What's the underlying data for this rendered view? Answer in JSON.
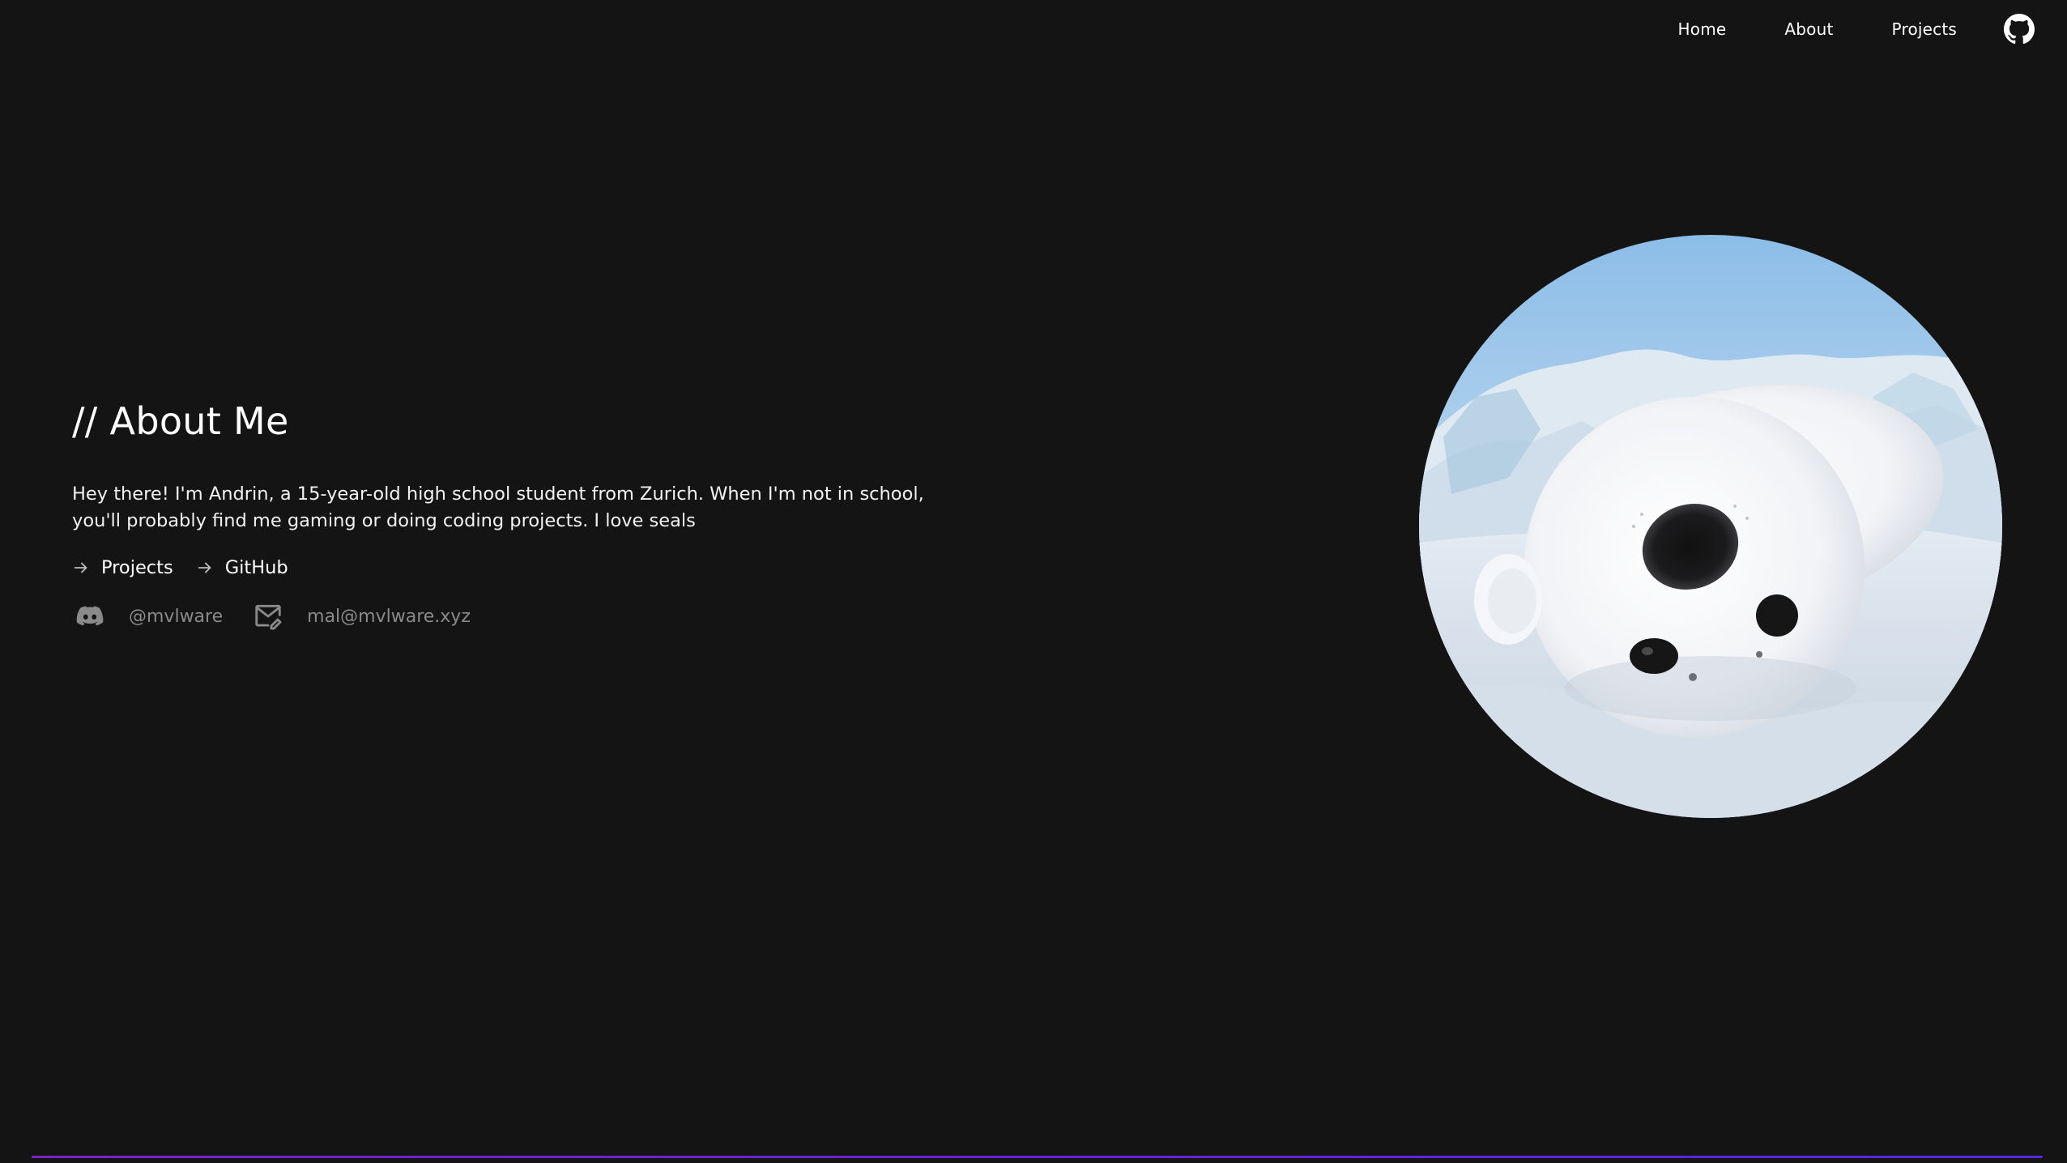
{
  "nav": {
    "items": [
      {
        "label": "Home"
      },
      {
        "label": "About"
      },
      {
        "label": "Projects"
      }
    ],
    "github_icon": "github-icon"
  },
  "about": {
    "heading_prefix": "//",
    "heading": "About Me",
    "bio_line1": "Hey there! I'm Andrin, a 15-year-old high school student from Zurich. When I'm not in school,",
    "bio_line2": "you'll probably find me gaming or doing coding projects. I love seals",
    "links": [
      {
        "label": "Projects",
        "icon": "arrow-right-icon"
      },
      {
        "label": "GitHub",
        "icon": "arrow-right-icon"
      }
    ],
    "contacts": [
      {
        "label": "@mvlware",
        "icon": "discord-icon"
      },
      {
        "label": "mal@mvlware.xyz",
        "icon": "mail-icon"
      }
    ]
  },
  "avatar": {
    "subject": "harp-seal-pup-photo"
  },
  "colors": {
    "background": "#141414",
    "text": "#ffffff",
    "muted": "#8a8a8a",
    "accent_gradient_start": "#7b21c6",
    "accent_gradient_end": "#5626e0"
  }
}
